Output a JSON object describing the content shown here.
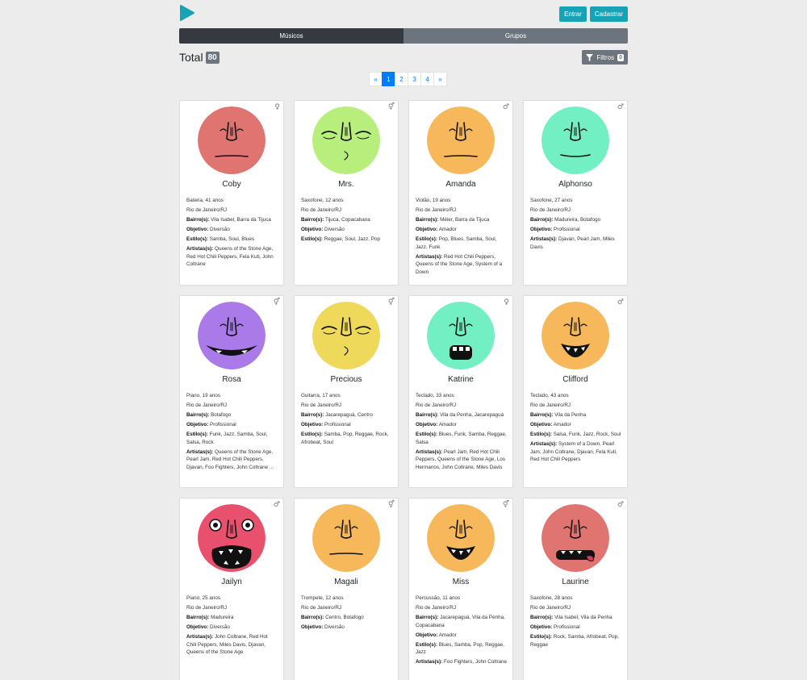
{
  "header": {
    "login_label": "Entrar",
    "signup_label": "Cadastrar"
  },
  "tabs": [
    {
      "label": "Músicos",
      "active": true
    },
    {
      "label": "Grupos",
      "active": false
    }
  ],
  "total": {
    "label": "Total",
    "count": "80"
  },
  "filters": {
    "label": "Filtros",
    "count": "0"
  },
  "pagination": {
    "prev": "«",
    "pages": [
      "1",
      "2",
      "3",
      "4"
    ],
    "current": "1",
    "next": "»"
  },
  "field_labels": {
    "bairros": "Bairro(s):",
    "objetivo": "Objetivo:",
    "estilos": "Estilo(s):",
    "artistas": "Artistas(s):"
  },
  "musicians": [
    {
      "name": "Coby",
      "gender": "♀",
      "color": "#e07470",
      "face": "neutral",
      "instrument_age": "Bateria, 41 anos",
      "city": "Rio de Janeiro/RJ",
      "bairros": "Vila Isabel, Barra da Tijuca",
      "objetivo": "Diversão",
      "estilos": "Samba, Soul, Blues",
      "artistas": "Queens of the Stone Age, Red Hot Chili Peppers, Fela Kuti, John Coltrane"
    },
    {
      "name": "Mrs.",
      "gender": "⚥",
      "color": "#b7ee7c",
      "face": "sleepy",
      "instrument_age": "Saxofone, 12 anos",
      "city": "Rio de Janeiro/RJ",
      "bairros": "Tijuca, Copacabana",
      "objetivo": "Diversão",
      "estilos": "Reggae, Soul, Jazz, Pop",
      "artistas": ""
    },
    {
      "name": "Amanda",
      "gender": "♂",
      "color": "#f6b85a",
      "face": "neutral",
      "instrument_age": "Violão, 19 anos",
      "city": "Rio de Janeiro/RJ",
      "bairros": "Méier, Barra da Tijuca",
      "objetivo": "Amador",
      "estilos": "Pop, Blues, Samba, Soul, Jazz, Funk",
      "artistas": "Red Hot Chili Peppers, Queens of the Stone Age, System of a Down"
    },
    {
      "name": "Alphonso",
      "gender": "♂",
      "color": "#72efc3",
      "face": "smile",
      "instrument_age": "Saxofone, 27 anos",
      "city": "Rio de Janeiro/RJ",
      "bairros": "Madureira, Botafogo",
      "objetivo": "Profissional",
      "estilos": "",
      "artistas": "Djavan, Pearl Jam, Miles Davis"
    },
    {
      "name": "Rosa",
      "gender": "⚥",
      "color": "#a97ae8",
      "face": "grin",
      "instrument_age": "Piano, 19 anos",
      "city": "Rio de Janeiro/RJ",
      "bairros": "Botafogo",
      "objetivo": "Profissional",
      "estilos": "Funk, Jazz, Samba, Soul, Salsa, Rock",
      "artistas": "Queens of the Stone Age, Pearl Jam, Red Hot Chili Peppers, Djavan, Foo Fighters, John Coltrane ..."
    },
    {
      "name": "Precious",
      "gender": "⚥",
      "color": "#efd95a",
      "face": "sleepy",
      "instrument_age": "Guitarra, 17 anos",
      "city": "Rio de Janeiro/RJ",
      "bairros": "Jacarepaguá, Centro",
      "objetivo": "Profissional",
      "estilos": "Samba, Pop, Reggae, Rock, Afrobeat, Soul",
      "artistas": ""
    },
    {
      "name": "Katrine",
      "gender": "♀",
      "color": "#72efc3",
      "face": "teeth",
      "instrument_age": "Teclado, 33 anos",
      "city": "Rio de Janeiro/RJ",
      "bairros": "Vila da Penha, Jacarepaguá",
      "objetivo": "Amador",
      "estilos": "Blues, Funk, Samba, Reggae, Salsa",
      "artistas": "Pearl Jam, Red Hot Chili Peppers, Queens of the Stone Age, Los Hermanos, John Coltrane, Miles Davis"
    },
    {
      "name": "Clifford",
      "gender": "♂",
      "color": "#f6b85a",
      "face": "open",
      "instrument_age": "Teclado, 43 anos",
      "city": "Rio de Janeiro/RJ",
      "bairros": "Vila da Penha",
      "objetivo": "Amador",
      "estilos": "Salsa, Funk, Jazz, Rock, Soul",
      "artistas": "System of a Down, Pearl Jam, John Coltrane, Djavan, Fela Kuti, Red Hot Chili Peppers"
    },
    {
      "name": "Jailyn",
      "gender": "♂",
      "color": "#e8506e",
      "face": "scream",
      "instrument_age": "Piano, 25 anos",
      "city": "Rio de Janeiro/RJ",
      "bairros": "Madureira",
      "objetivo": "Diversão",
      "estilos": "",
      "artistas": "John Coltrane, Red Hot Chili Peppers, Miles Davis, Djavan, Queens of the Stone Age"
    },
    {
      "name": "Magali",
      "gender": "⚥",
      "color": "#f6b85a",
      "face": "neutral",
      "instrument_age": "Trompete, 12 anos",
      "city": "Rio de Janeiro/RJ",
      "bairros": "Centro, Botafogo",
      "objetivo": "Diversão",
      "estilos": "",
      "artistas": ""
    },
    {
      "name": "Miss",
      "gender": "⚥",
      "color": "#f6b85a",
      "face": "open",
      "instrument_age": "Percussão, 11 anos",
      "city": "Rio de Janeiro/RJ",
      "bairros": "Jacarepaguá, Vila da Penha, Copacabana",
      "objetivo": "Amador",
      "estilos": "Blues, Samba, Pop, Reggae, Jazz",
      "artistas": "Foo Fighters, John Coltrane"
    },
    {
      "name": "Laurine",
      "gender": "♂",
      "color": "#e07470",
      "face": "tongue",
      "instrument_age": "Saxofone, 28 anos",
      "city": "Rio de Janeiro/RJ",
      "bairros": "Vila Isabel, Vila da Penha",
      "objetivo": "Profissional",
      "estilos": "Rock, Samba, Afrobeat, Pop, Reggae",
      "artistas": ""
    }
  ]
}
